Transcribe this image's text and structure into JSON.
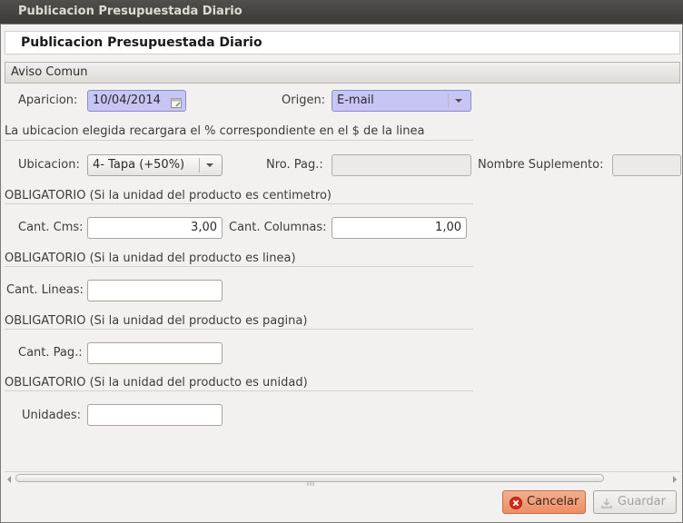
{
  "window": {
    "title": "Publicacion Presupuestada Diario"
  },
  "header": {
    "title": "Publicacion Presupuestada Diario"
  },
  "section": {
    "title": "Aviso Comun"
  },
  "form": {
    "aparicion": {
      "label": "Aparicion:",
      "value": "10/04/2014"
    },
    "origen": {
      "label": "Origen:",
      "value": "E-mail"
    },
    "ubicacion_note": "La ubicacion elegida recargara el % correspondiente en el $ de la linea",
    "ubicacion": {
      "label": "Ubicacion:",
      "value": "4- Tapa (+50%)"
    },
    "nro_pag": {
      "label": "Nro. Pag.:",
      "value": ""
    },
    "nombre_suplemento": {
      "label": "Nombre Suplemento:",
      "value": ""
    },
    "note_cm": "OBLIGATORIO (Si la unidad del producto es centimetro)",
    "cant_cms": {
      "label": "Cant. Cms:",
      "value": "3,00"
    },
    "cant_columnas": {
      "label": "Cant. Columnas:",
      "value": "1,00"
    },
    "note_linea": "OBLIGATORIO (Si la unidad del producto es linea)",
    "cant_lineas": {
      "label": "Cant. Lineas:",
      "value": ""
    },
    "note_pagina": "OBLIGATORIO (Si la unidad del producto es pagina)",
    "cant_pag": {
      "label": "Cant. Pag.:",
      "value": ""
    },
    "note_unidad": "OBLIGATORIO (Si la unidad del producto es unidad)",
    "unidades": {
      "label": "Unidades:",
      "value": ""
    }
  },
  "buttons": {
    "cancel": "Cancelar",
    "save": "Guardar"
  },
  "colors": {
    "highlight_field": "#c7c5f3",
    "cancel_button": "#ee8d63",
    "title_bar": "#3c3b37"
  },
  "icons": {
    "calendar": "calendar-icon",
    "cancel": "cancel-icon",
    "save": "save-icon"
  }
}
